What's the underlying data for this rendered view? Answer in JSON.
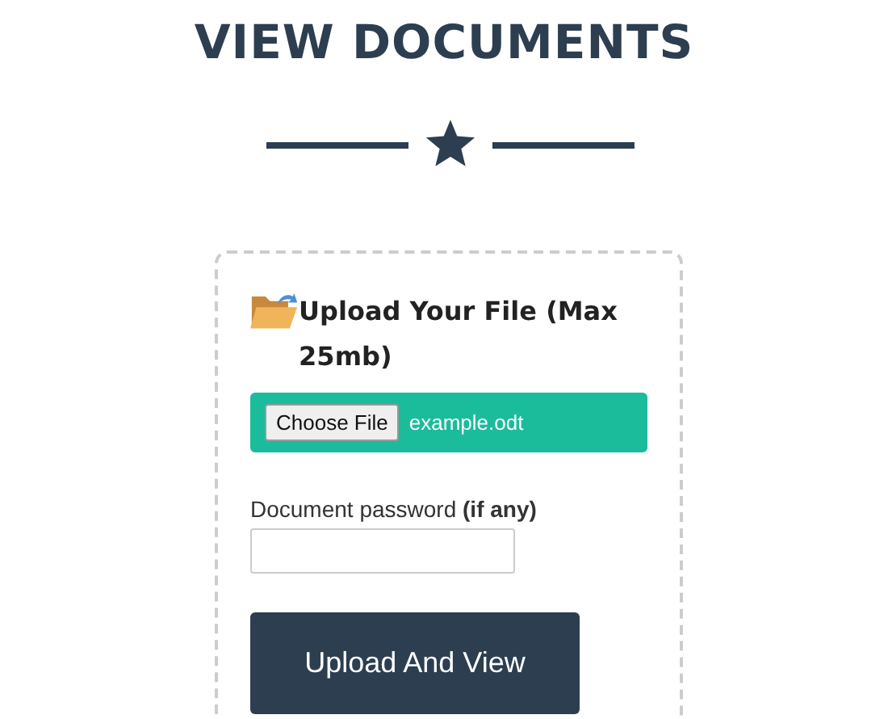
{
  "heading": "VIEW DOCUMENTS",
  "form": {
    "title": "Upload Your File (Max 25mb)",
    "file_button": "Choose File",
    "file_name": "example.odt",
    "password_label": "Document password **(if any)**",
    "submit": "Upload And View"
  }
}
